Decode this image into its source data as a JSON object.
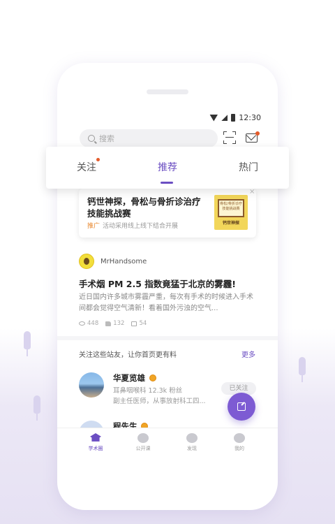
{
  "status_bar": {
    "time": "12:30"
  },
  "search": {
    "placeholder": "搜索"
  },
  "tabs": [
    {
      "label": "关注",
      "has_dot": true
    },
    {
      "label": "推荐",
      "active": true
    },
    {
      "label": "热门"
    }
  ],
  "promo": {
    "title": "钙世神探，骨松与骨折诊治疗技能挑战赛",
    "tag": "推广",
    "subtitle": "活动采用线上线下结合开展",
    "image_board_text": "骨松/骨折诊疗技能挑战赛",
    "image_label": "钙世神探"
  },
  "post": {
    "author": "MrHandsome",
    "title": "手术烟 PM 2.5 指数竟猛于北京的雾霾!",
    "excerpt": "近日国内许多城市雾霾严重，每次有手术的时候进入手术间都会觉得空气清新！看着国外污浊的空气...",
    "views": "448",
    "likes": "132",
    "comments": "54"
  },
  "follow_section": {
    "hint": "关注这些站友，让你首页更有料",
    "more": "更多",
    "users": [
      {
        "name": "华夏览雄",
        "dept_fans": "耳鼻咽喉科 12.3k 粉丝",
        "title": "副主任医师，从事放射科工四...",
        "follow_label": "已关注"
      },
      {
        "name": "程先生"
      }
    ]
  },
  "bottom_nav": [
    {
      "label": "学术圈",
      "active": true
    },
    {
      "label": "公开课"
    },
    {
      "label": "发现"
    },
    {
      "label": "我的"
    }
  ],
  "colors": {
    "accent": "#6b4ec2",
    "fab": "#7d5bd3",
    "badge": "#e45c2c"
  }
}
